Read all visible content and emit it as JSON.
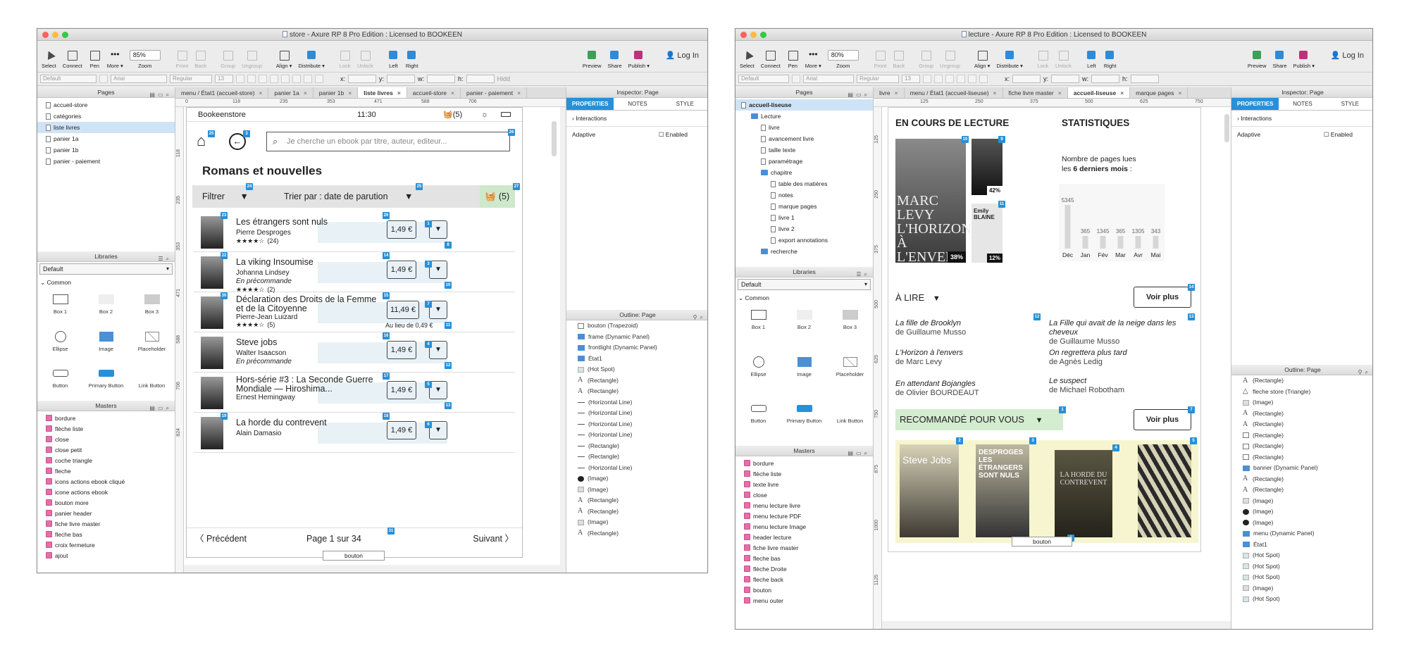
{
  "left_window": {
    "title": "store - Axure RP 8 Pro Edition : Licensed to BOOKEEN",
    "toolbar": {
      "buttons": [
        "Select",
        "Connect",
        "Pen",
        "More ▾"
      ],
      "zoom_value": "85%",
      "zoom_label": "Zoom",
      "nav_buttons": [
        "Front",
        "Back",
        "Group",
        "Ungroup"
      ],
      "align_buttons": [
        "Align ▾",
        "Distribute ▾",
        "Lock",
        "Unlock",
        "Left",
        "Right"
      ],
      "right_buttons": [
        "Preview",
        "Share",
        "Publish ▾"
      ],
      "login": "Log In"
    },
    "format_bar": {
      "style": "Default",
      "font": "Arial",
      "weight": "Regular",
      "size": "13",
      "x_label": "x:",
      "y_label": "y:",
      "w_label": "w:",
      "h_label": "h:",
      "hidden_label": "Hidd"
    },
    "pages": {
      "header": "Pages",
      "items": [
        "accueil-store",
        "catégories",
        "liste livres",
        "panier 1a",
        "panier 1b",
        "panier - paiement"
      ],
      "selected": "liste livres"
    },
    "libraries": {
      "header": "Libraries",
      "select": "Default",
      "group": "Common",
      "widgets": [
        "Box 1",
        "Box 2",
        "Box 3",
        "Ellipse",
        "Image",
        "Placeholder",
        "Button",
        "Primary Button",
        "Link Button"
      ]
    },
    "masters": {
      "header": "Masters",
      "items": [
        "bordure",
        "flèche liste",
        "close",
        "close petit",
        "coche triangle",
        "fleche",
        "icons actions ebook cliqué",
        "icone actions ebook",
        "bouton more",
        "panier header",
        "fiche livre master",
        "fleche bas",
        "croix fermeture",
        "ajout"
      ]
    },
    "tabs": [
      {
        "label": "menu / État1 (accueil-store)",
        "active": false
      },
      {
        "label": "panier 1a",
        "active": false
      },
      {
        "label": "panier 1b",
        "active": false
      },
      {
        "label": "liste livres",
        "active": true
      },
      {
        "label": "accueil-store",
        "active": false
      },
      {
        "label": "panier - paiement",
        "active": false
      }
    ],
    "ruler": [
      "0",
      "118",
      "235",
      "353",
      "471",
      "588",
      "706"
    ],
    "vruler": [
      "118",
      "235",
      "353",
      "471",
      "588",
      "706",
      "824"
    ],
    "device": {
      "store_name": "Bookeenstore",
      "time": "11:30",
      "cart_count": "(5)",
      "search_placeholder": "Je cherche un ebook par titre, auteur, editeur...",
      "heading": "Romans et nouvelles",
      "filter_label": "Filtrer",
      "sort_label": "Trier par : date de parution",
      "cart_badge": "(5)",
      "books": [
        {
          "title": "Les étrangers sont nuls",
          "author": "Pierre Desproges",
          "rating": "★★★★☆",
          "reviews": "(24)",
          "extra": "",
          "price": "1,49 €",
          "old_price": ""
        },
        {
          "title": "La viking Insoumise",
          "author": "Johanna Lindsey",
          "rating": "★★★★☆",
          "reviews": "(2)",
          "extra": "En précommande",
          "price": "1,49 €",
          "old_price": ""
        },
        {
          "title": "Déclaration des Droits de la Femme et de la Citoyenne",
          "author": "Pierre-Jean Luizard",
          "rating": "★★★★☆",
          "reviews": "(5)",
          "extra": "",
          "price": "11,49 €",
          "old_price": "Au lieu de 0,49 €"
        },
        {
          "title": "Steve jobs",
          "author": "Walter Isaacson",
          "rating": "",
          "reviews": "",
          "extra": "En précommande",
          "price": "1,49 €",
          "old_price": ""
        },
        {
          "title": "Hors-série #3 : La Seconde Guerre Mondiale — Hiroshima...",
          "author": "Ernest Hemingway",
          "rating": "",
          "reviews": "",
          "extra": "",
          "price": "1,49 €",
          "old_price": ""
        },
        {
          "title": "La horde du contrevent",
          "author": "Alain Damasio",
          "rating": "",
          "reviews": "",
          "extra": "",
          "price": "1,49 €",
          "old_price": ""
        }
      ],
      "prev_label": "Précédent",
      "next_label": "Suivant",
      "page_info": "Page 1 sur 34",
      "bouton_label": "bouton"
    },
    "inspector": {
      "header": "Inspector: Page",
      "tabs": [
        "PROPERTIES",
        "NOTES",
        "STYLE"
      ],
      "interactions": "Interactions",
      "adaptive": "Adaptive",
      "enabled": "Enabled"
    },
    "outline": {
      "header": "Outline: Page",
      "items": [
        {
          "label": "bouton (Trapezoid)",
          "icon": "sq"
        },
        {
          "label": "frame (Dynamic Panel)",
          "icon": "folder"
        },
        {
          "label": "frontlight (Dynamic Panel)",
          "icon": "folder"
        },
        {
          "label": "État1",
          "icon": "folder"
        },
        {
          "label": "(Hot Spot)",
          "icon": "fill"
        },
        {
          "label": "(Rectangle)",
          "icon": "A"
        },
        {
          "label": "(Rectangle)",
          "icon": "A"
        },
        {
          "label": "(Horizontal Line)",
          "icon": "line"
        },
        {
          "label": "(Horizontal Line)",
          "icon": "line"
        },
        {
          "label": "(Horizontal Line)",
          "icon": "line"
        },
        {
          "label": "(Horizontal Line)",
          "icon": "line"
        },
        {
          "label": "(Rectangle)",
          "icon": "line"
        },
        {
          "label": "(Rectangle)",
          "icon": "line"
        },
        {
          "label": "(Horizontal Line)",
          "icon": "line"
        },
        {
          "label": "(Image)",
          "icon": "blk"
        },
        {
          "label": "(Image)",
          "icon": "img"
        },
        {
          "label": "(Rectangle)",
          "icon": "A"
        },
        {
          "label": "(Rectangle)",
          "icon": "A"
        },
        {
          "label": "(Image)",
          "icon": "img"
        },
        {
          "label": "(Rectangle)",
          "icon": "A"
        }
      ]
    }
  },
  "right_window": {
    "title": "lecture - Axure RP 8 Pro Edition : Licensed to BOOKEEN",
    "toolbar": {
      "zoom_value": "80%",
      "login": "Log In"
    },
    "pages": {
      "header": "Pages",
      "items": [
        {
          "label": "accueil-liseuse",
          "depth": 0,
          "type": "page",
          "selected": true
        },
        {
          "label": "Lecture",
          "depth": 1,
          "type": "folder"
        },
        {
          "label": "livre",
          "depth": 2,
          "type": "page"
        },
        {
          "label": "avancement livre",
          "depth": 2,
          "type": "page"
        },
        {
          "label": "taille texte",
          "depth": 2,
          "type": "page"
        },
        {
          "label": "paramétrage",
          "depth": 2,
          "type": "page"
        },
        {
          "label": "chapitre",
          "depth": 2,
          "type": "folder"
        },
        {
          "label": "table des matières",
          "depth": 3,
          "type": "page"
        },
        {
          "label": "notes",
          "depth": 3,
          "type": "page"
        },
        {
          "label": "marque pages",
          "depth": 3,
          "type": "page"
        },
        {
          "label": "livre 1",
          "depth": 3,
          "type": "page"
        },
        {
          "label": "livre 2",
          "depth": 3,
          "type": "page"
        },
        {
          "label": "export annotations",
          "depth": 3,
          "type": "page"
        },
        {
          "label": "recherche",
          "depth": 2,
          "type": "folder"
        }
      ]
    },
    "masters": {
      "items": [
        "bordure",
        "flèche liste",
        "texte livre",
        "close",
        "menu lecture livre",
        "menu lecture PDF",
        "menu lecture Image",
        "header lecture",
        "fiche livre master",
        "fleche bas",
        "flèche Droite",
        "fleche back",
        "bouton",
        "menu outer"
      ]
    },
    "tabs": [
      {
        "label": "livre",
        "active": false
      },
      {
        "label": "menu / État1 (accueil-liseuse)",
        "active": false
      },
      {
        "label": "fiche livre master",
        "active": false
      },
      {
        "label": "accueil-liseuse",
        "active": true
      },
      {
        "label": "marque pages",
        "active": false
      }
    ],
    "ruler": [
      "125",
      "250",
      "375",
      "500",
      "625",
      "750"
    ],
    "vruler": [
      "125",
      "250",
      "375",
      "500",
      "625",
      "750",
      "875",
      "1000",
      "1125"
    ],
    "device": {
      "reading_title": "EN COURS DE LECTURE",
      "stats_title": "STATISTIQUES",
      "covers": [
        {
          "text": "MARC LEVY L'HORIZON À L'ENVERS",
          "pct": "38%"
        },
        {
          "text": "",
          "pct": "42%"
        },
        {
          "text": "Emily BLAINE",
          "pct": "12%"
        }
      ],
      "stats_text_1": "Nombre de pages lues",
      "stats_text_2a": "les ",
      "stats_text_2b": "6 derniers mois",
      "stats_text_2c": " :",
      "to_read": "À LIRE",
      "voir_plus": "Voir plus",
      "to_read_list": [
        {
          "title": "La fille de Brooklyn",
          "author": "de Guillaume Musso"
        },
        {
          "title": "L'Horizon à l'envers",
          "author": "de Marc Levy"
        },
        {
          "title": "En attendant Bojangles",
          "author": "de Olivier BOURDEAUT"
        },
        {
          "title": "La Fille qui avait de la neige dans les cheveux",
          "author": "de Guillaume Musso"
        },
        {
          "title": "On regrettera plus tard",
          "author": "de Agnès Ledig"
        },
        {
          "title": "Le suspect",
          "author": "de Michael Robotham"
        }
      ],
      "recommended": "RECOMMANDÉ POUR VOUS",
      "voir_plus_2": "Voir plus",
      "rec_covers": [
        "Steve Jobs",
        "DESPROGES LES ÉTRANGERS SONT NULS",
        "LA HORDE DU CONTREVENT",
        ""
      ],
      "bouton_label": "bouton"
    },
    "inspector": {
      "header": "Inspector: Page",
      "tabs": [
        "PROPERTIES",
        "NOTES",
        "STYLE"
      ],
      "interactions": "Interactions",
      "adaptive": "Adaptive",
      "enabled": "Enabled"
    },
    "outline": {
      "header": "Outline: Page",
      "items": [
        {
          "label": "(Rectangle)",
          "icon": "A"
        },
        {
          "label": "fleche store (Triangle)",
          "icon": "tri"
        },
        {
          "label": "(Image)",
          "icon": "img"
        },
        {
          "label": "(Rectangle)",
          "icon": "A"
        },
        {
          "label": "(Rectangle)",
          "icon": "A"
        },
        {
          "label": "(Rectangle)",
          "icon": "sq"
        },
        {
          "label": "(Rectangle)",
          "icon": "sq"
        },
        {
          "label": "(Rectangle)",
          "icon": "sq"
        },
        {
          "label": "banner (Dynamic Panel)",
          "icon": "folder"
        },
        {
          "label": "(Rectangle)",
          "icon": "A"
        },
        {
          "label": "(Rectangle)",
          "icon": "A"
        },
        {
          "label": "(Image)",
          "icon": "img"
        },
        {
          "label": "(Image)",
          "icon": "blk"
        },
        {
          "label": "(Image)",
          "icon": "blk"
        },
        {
          "label": "menu (Dynamic Panel)",
          "icon": "folder"
        },
        {
          "label": "État1",
          "icon": "folder"
        },
        {
          "label": "(Hot Spot)",
          "icon": "fill"
        },
        {
          "label": "(Hot Spot)",
          "icon": "fill"
        },
        {
          "label": "(Hot Spot)",
          "icon": "fill"
        },
        {
          "label": "(Image)",
          "icon": "img"
        },
        {
          "label": "(Hot Spot)",
          "icon": "fill"
        }
      ]
    }
  },
  "chart_data": {
    "type": "bar",
    "categories": [
      "Déc",
      "Jan",
      "Fév",
      "Mar",
      "Avr",
      "Mai"
    ],
    "values": [
      5345,
      365,
      1345,
      365,
      1305,
      343
    ],
    "ylabel": "",
    "xlabel": ""
  },
  "colors": {
    "accent_blue": "#2790d8",
    "recommended_green": "#d4ecd0",
    "rec_bg": "#f7f5cf",
    "badge_blue": "#2790d8"
  }
}
